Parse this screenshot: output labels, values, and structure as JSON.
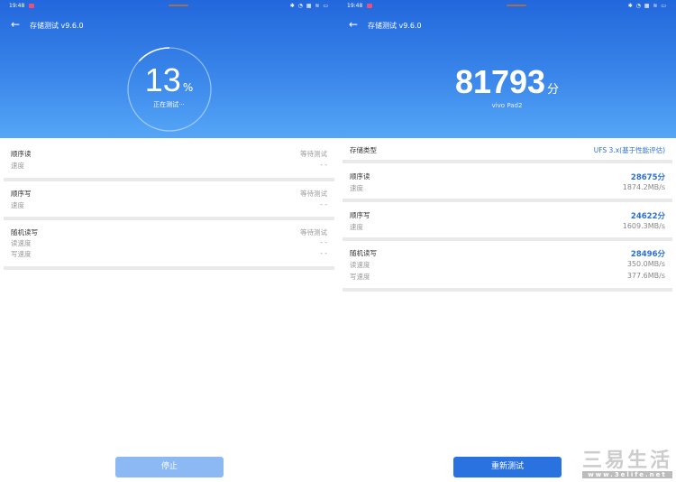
{
  "status_bar": {
    "time": "19:48",
    "icons": "✱ ◔ ▦ ≋ ▭"
  },
  "left": {
    "title": "存储测试 v9.6.0",
    "progress_percent": 13,
    "progress_value": "13",
    "progress_unit": "%",
    "progress_status": "正在测试···",
    "items": [
      {
        "label": "顺序读",
        "status": "等待测试",
        "rows": [
          {
            "label": "速度",
            "value": "- -"
          }
        ]
      },
      {
        "label": "顺序写",
        "status": "等待测试",
        "rows": [
          {
            "label": "速度",
            "value": "- -"
          }
        ]
      },
      {
        "label": "随机读写",
        "status": "等待测试",
        "rows": [
          {
            "label": "读速度",
            "value": "- -"
          },
          {
            "label": "写速度",
            "value": "- -"
          }
        ]
      }
    ],
    "stop_button": "停止"
  },
  "right": {
    "title": "存储测试 v9.6.0",
    "score": "81793",
    "score_unit": "分",
    "device": "vivo Pad2",
    "storage_type_label": "存储类型",
    "storage_type_value": "UFS 3.x(基于性能评估)",
    "items": [
      {
        "label": "顺序读",
        "score": "28675分",
        "rows": [
          {
            "label": "速度",
            "value": "1874.2MB/s"
          }
        ]
      },
      {
        "label": "顺序写",
        "score": "24622分",
        "rows": [
          {
            "label": "速度",
            "value": "1609.3MB/s"
          }
        ]
      },
      {
        "label": "随机读写",
        "score": "28496分",
        "rows": [
          {
            "label": "读速度",
            "value": "350.0MB/s"
          },
          {
            "label": "写速度",
            "value": "377.6MB/s"
          }
        ]
      }
    ],
    "retest_button": "重新测试"
  },
  "watermark": {
    "title": "三易生活",
    "url": "www.3elife.net"
  },
  "colors": {
    "header_top": "#2267dc",
    "header_bottom": "#55a6f7",
    "accent": "#2d6fd3",
    "button": "#2a72e0",
    "button_disabled": "#8cb8f3"
  }
}
